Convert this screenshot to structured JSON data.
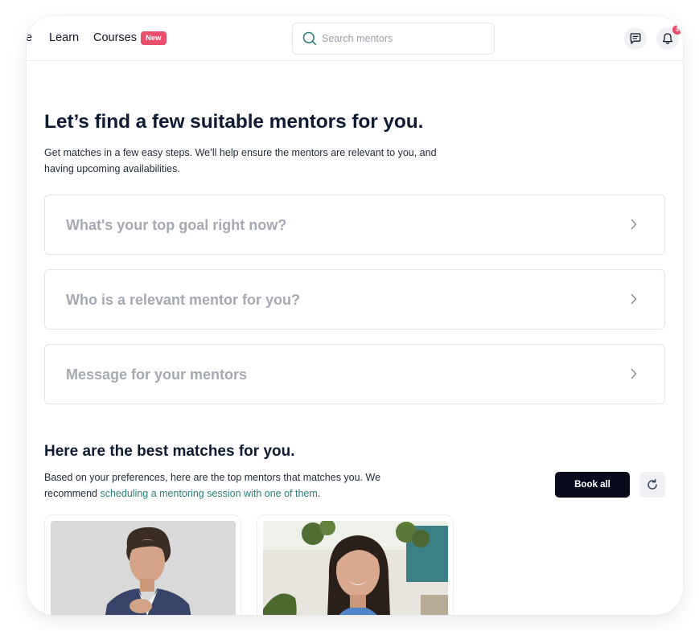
{
  "nav": {
    "partial_item": "e",
    "learn": "Learn",
    "courses": "Courses",
    "courses_badge": "New"
  },
  "search": {
    "placeholder": "Search mentors",
    "icon": "search-icon"
  },
  "header_icons": {
    "messages_icon": "chat-icon",
    "notifications_icon": "bell-icon",
    "notification_count": "3"
  },
  "intro": {
    "title": "Let’s find a few suitable mentors for you.",
    "subtitle": "Get matches in a few easy steps. We’ll help ensure the mentors are relevant to you, and having upcoming availabilities."
  },
  "steps": [
    {
      "label": "What's your top goal right now?"
    },
    {
      "label": "Who is a relevant mentor for you?"
    },
    {
      "label": "Message for your mentors"
    }
  ],
  "matches": {
    "title": "Here are the best matches for you.",
    "text_before_link": "Based on your preferences, here are the top mentors that matches you. We recommend ",
    "link_text": "scheduling a mentoring session with one of them",
    "text_after_link": ".",
    "book_all_label": "Book all",
    "refresh_icon": "refresh-icon"
  },
  "colors": {
    "accent_badge": "#ec4e6d",
    "primary_button": "#070b1c",
    "link": "#2a7f7a",
    "heading": "#0f1b33",
    "placeholder_text": "#a4a9b2"
  }
}
